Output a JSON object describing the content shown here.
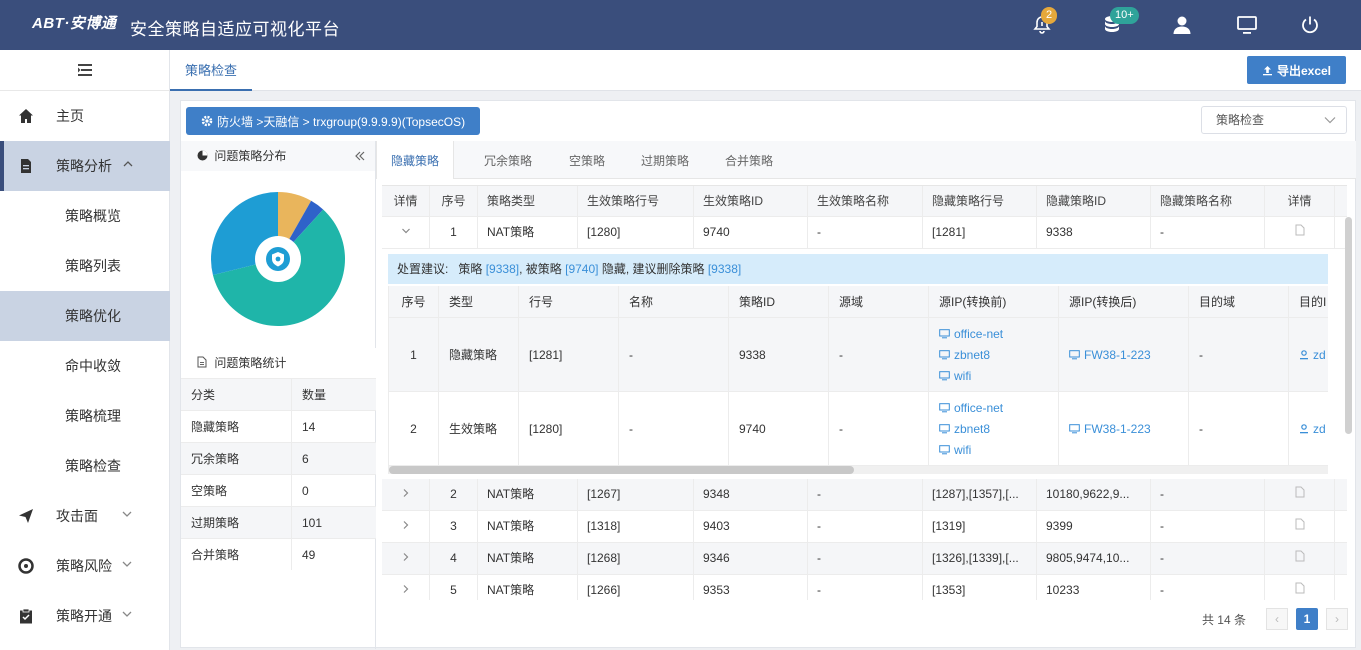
{
  "header": {
    "logo": "ABT·安博通",
    "title": "安全策略自适应可视化平台",
    "alert_badge": "2",
    "db_badge": "10+",
    "icons": [
      "bell-alert-icon",
      "database-icon",
      "user-icon",
      "monitor-icon",
      "power-icon"
    ]
  },
  "sidebar": {
    "items": [
      {
        "label": "主页",
        "icon": "home-icon"
      },
      {
        "label": "策略分析",
        "icon": "doc-icon"
      },
      {
        "label": "策略概览"
      },
      {
        "label": "策略列表"
      },
      {
        "label": "策略优化"
      },
      {
        "label": "命中收敛"
      },
      {
        "label": "策略梳理"
      },
      {
        "label": "策略检查"
      },
      {
        "label": "攻击面",
        "icon": "send-icon"
      },
      {
        "label": "策略风险",
        "icon": "target-icon"
      },
      {
        "label": "策略开通",
        "icon": "clipboard-icon"
      }
    ]
  },
  "tabbar": {
    "tab": "策略检查",
    "export_label": "导出excel"
  },
  "toolbar": {
    "breadcrumb": "防火墙 >天融信 > trxgroup(9.9.9.9)(TopsecOS)",
    "select_value": "策略检查"
  },
  "left": {
    "dist_title": "问题策略分布",
    "stat_title": "问题策略统计",
    "stat_headers": [
      "分类",
      "数量"
    ],
    "stats": [
      {
        "name": "隐藏策略",
        "count": "14"
      },
      {
        "name": "冗余策略",
        "count": "6"
      },
      {
        "name": "空策略",
        "count": "0"
      },
      {
        "name": "过期策略",
        "count": "101"
      },
      {
        "name": "合并策略",
        "count": "49"
      }
    ],
    "pie": [
      {
        "name": "隐藏策略",
        "value": 14,
        "color": "#e9b55c"
      },
      {
        "name": "冗余策略",
        "value": 6,
        "color": "#2f62c9"
      },
      {
        "name": "空策略",
        "value": 0,
        "color": "#888888"
      },
      {
        "name": "过期策略",
        "value": 101,
        "color": "#1fb5a9"
      },
      {
        "name": "合并策略",
        "value": 49,
        "color": "#1e9dd4"
      }
    ]
  },
  "subtabs": [
    "隐藏策略",
    "冗余策略",
    "空策略",
    "过期策略",
    "合并策略"
  ],
  "table": {
    "headers": [
      "详情",
      "序号",
      "策略类型",
      "生效策略行号",
      "生效策略ID",
      "生效策略名称",
      "隐藏策略行号",
      "隐藏策略ID",
      "隐藏策略名称",
      "详情"
    ],
    "rows": [
      {
        "no": "1",
        "type": "NAT策略",
        "eff_line": "[1280]",
        "eff_id": "9740",
        "eff_name": "-",
        "hid_line": "[1281]",
        "hid_id": "9338",
        "hid_name": "-"
      },
      {
        "no": "2",
        "type": "NAT策略",
        "eff_line": "[1267]",
        "eff_id": "9348",
        "eff_name": "-",
        "hid_line": "[1287],[1357],[...",
        "hid_id": "10180,9622,9...",
        "hid_name": "-"
      },
      {
        "no": "3",
        "type": "NAT策略",
        "eff_line": "[1318]",
        "eff_id": "9403",
        "eff_name": "-",
        "hid_line": "[1319]",
        "hid_id": "9399",
        "hid_name": "-"
      },
      {
        "no": "4",
        "type": "NAT策略",
        "eff_line": "[1268]",
        "eff_id": "9346",
        "eff_name": "-",
        "hid_line": "[1326],[1339],[...",
        "hid_id": "9805,9474,10...",
        "hid_name": "-"
      },
      {
        "no": "5",
        "type": "NAT策略",
        "eff_line": "[1266]",
        "eff_id": "9353",
        "eff_name": "-",
        "hid_line": "[1353]",
        "hid_id": "10233",
        "hid_name": "-"
      }
    ]
  },
  "advice": {
    "prefix": "处置建议:",
    "t1": "策略",
    "id1": "[9338]",
    "t2": ", 被策略",
    "id2": "[9740]",
    "t3": "隐藏, 建议删除策略",
    "id3": "[9338]"
  },
  "inner": {
    "headers": [
      "序号",
      "类型",
      "行号",
      "名称",
      "策略ID",
      "源域",
      "源IP(转换前)",
      "源IP(转换后)",
      "目的域",
      "目的I"
    ],
    "rows": [
      {
        "no": "1",
        "type": "隐藏策略",
        "line": "[1281]",
        "name": "-",
        "id": "9338",
        "src_zone": "-",
        "src_pre": [
          "office-net",
          "zbnet8",
          "wifi"
        ],
        "src_post": "FW38-1-223",
        "dst_zone": "-",
        "dst": "zd"
      },
      {
        "no": "2",
        "type": "生效策略",
        "line": "[1280]",
        "name": "-",
        "id": "9740",
        "src_zone": "-",
        "src_pre": [
          "office-net",
          "zbnet8",
          "wifi"
        ],
        "src_post": "FW38-1-223",
        "dst_zone": "-",
        "dst": "zd"
      }
    ]
  },
  "pager": {
    "total": "共 14 条",
    "current": "1"
  }
}
